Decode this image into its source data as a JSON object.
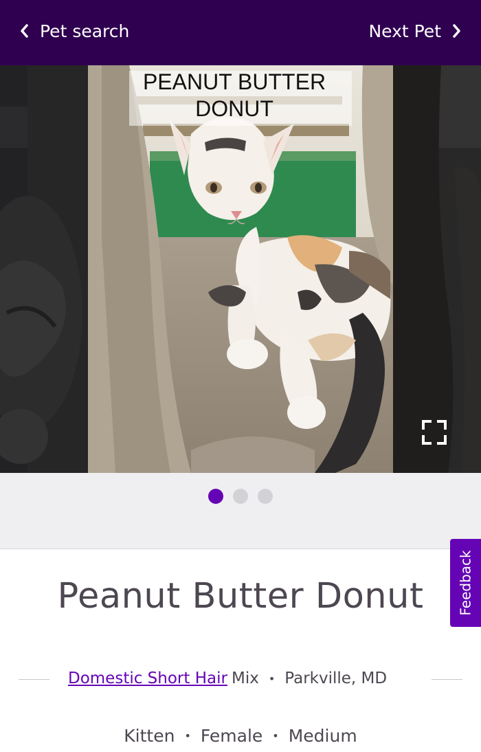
{
  "header": {
    "back_label": "Pet search",
    "next_label": "Next Pet"
  },
  "gallery": {
    "photo_caption_line1": "PEANUT BUTTER",
    "photo_caption_line2": "DONUT",
    "photo_count": 3,
    "active_index": 0
  },
  "feedback_label": "Feedback",
  "pet": {
    "name": "Peanut Butter Donut",
    "breed": "Domestic Short Hair",
    "breed_suffix": "Mix",
    "location": "Parkville, MD",
    "age": "Kitten",
    "sex": "Female",
    "size": "Medium",
    "bullet": "•"
  },
  "colors": {
    "brand_dark": "#2f0050",
    "brand_purple": "#6504b5",
    "inactive_dot": "#d2d2d6"
  }
}
